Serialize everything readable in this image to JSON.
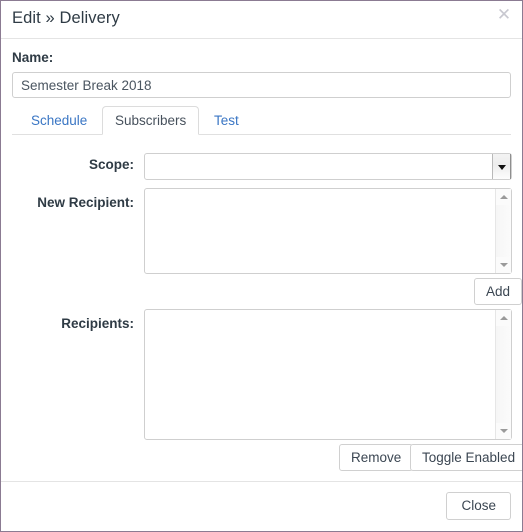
{
  "dialog": {
    "title": "Edit » Delivery",
    "close_icon": "close-x-icon"
  },
  "form": {
    "name_label": "Name:",
    "name_value": "Semester Break 2018",
    "name_placeholder": ""
  },
  "tabs": [
    {
      "label": "Schedule",
      "active": false
    },
    {
      "label": "Subscribers",
      "active": true
    },
    {
      "label": "Test",
      "active": false
    }
  ],
  "subscribers": {
    "scope_label": "Scope:",
    "scope_value": "",
    "scope_arrow_icon": "chevron-down-icon",
    "new_recipient_label": "New Recipient:",
    "new_recipient_value": "",
    "add_label": "Add",
    "recipients_label": "Recipients:",
    "recipients_value": "",
    "remove_label": "Remove",
    "toggle_enabled_label": "Toggle Enabled"
  },
  "footer": {
    "close_label": "Close"
  },
  "colors": {
    "dialog_border": "#8b7b92",
    "tab_link": "#3a76c4",
    "text": "#2f3b45",
    "divider": "#e4e4e4"
  }
}
